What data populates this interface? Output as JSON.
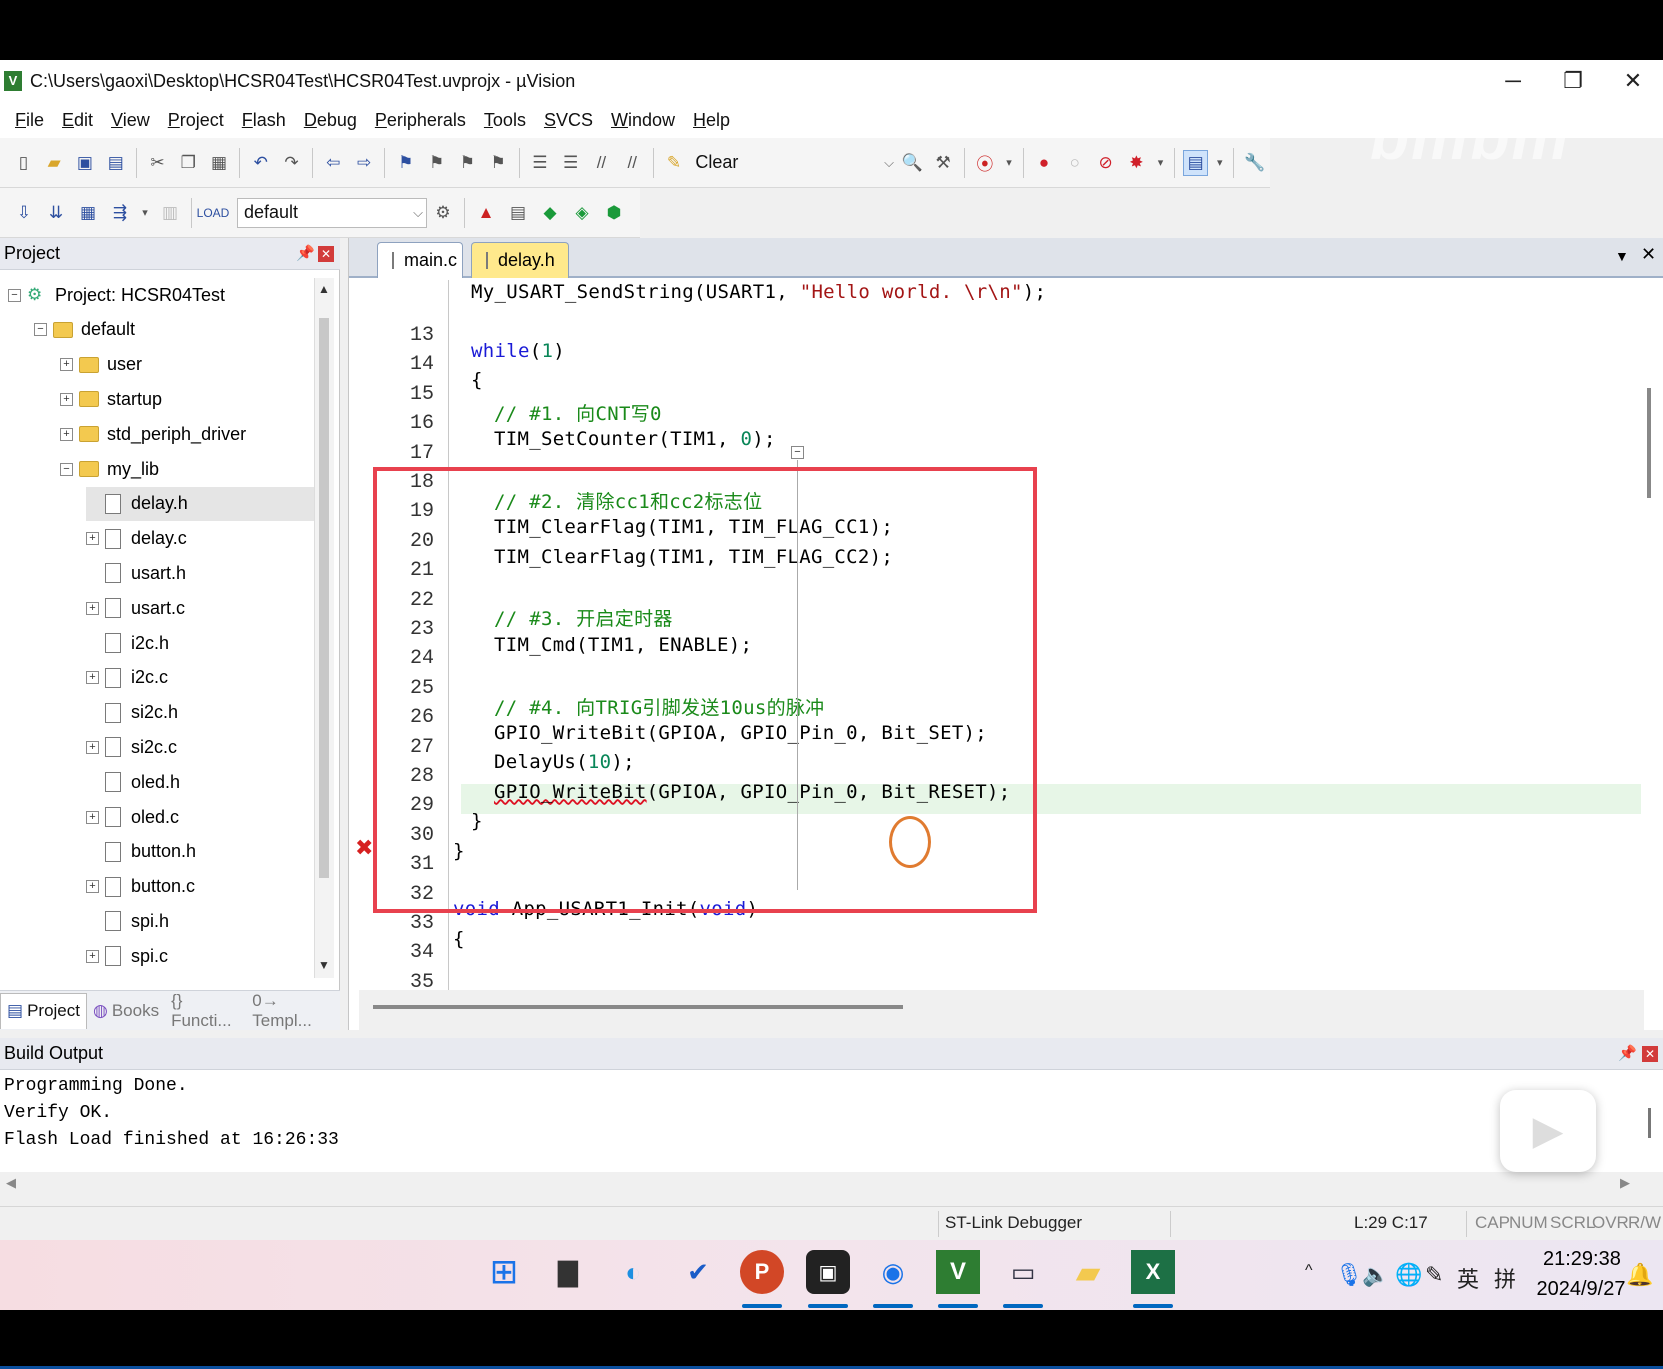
{
  "window": {
    "title": "C:\\Users\\gaoxi\\Desktop\\HCSR04Test\\HCSR04Test.uvprojx - µVision",
    "controls": {
      "minimize": "─",
      "maximize": "❐",
      "close": "✕"
    }
  },
  "menu": [
    "File",
    "Edit",
    "View",
    "Project",
    "Flash",
    "Debug",
    "Peripherals",
    "Tools",
    "SVCS",
    "Window",
    "Help"
  ],
  "toolbar1": {
    "clear_label": "Clear"
  },
  "toolbar2": {
    "target": "default"
  },
  "project_panel": {
    "header": "Project",
    "root": "Project: HCSR04Test",
    "target": "default",
    "items": [
      {
        "label": "user",
        "type": "folder",
        "expander": "+"
      },
      {
        "label": "startup",
        "type": "folder",
        "expander": "+"
      },
      {
        "label": "std_periph_driver",
        "type": "folder",
        "expander": "+"
      },
      {
        "label": "my_lib",
        "type": "folder",
        "expander": "−"
      },
      {
        "label": "delay.h",
        "type": "file",
        "expander": "",
        "selected": true
      },
      {
        "label": "delay.c",
        "type": "file",
        "expander": "+"
      },
      {
        "label": "usart.h",
        "type": "file",
        "expander": ""
      },
      {
        "label": "usart.c",
        "type": "file",
        "expander": "+"
      },
      {
        "label": "i2c.h",
        "type": "file",
        "expander": ""
      },
      {
        "label": "i2c.c",
        "type": "file",
        "expander": "+"
      },
      {
        "label": "si2c.h",
        "type": "file",
        "expander": ""
      },
      {
        "label": "si2c.c",
        "type": "file",
        "expander": "+"
      },
      {
        "label": "oled.h",
        "type": "file",
        "expander": ""
      },
      {
        "label": "oled.c",
        "type": "file",
        "expander": "+"
      },
      {
        "label": "button.h",
        "type": "file",
        "expander": ""
      },
      {
        "label": "button.c",
        "type": "file",
        "expander": "+"
      },
      {
        "label": "spi.h",
        "type": "file",
        "expander": ""
      },
      {
        "label": "spi.c",
        "type": "file",
        "expander": "+"
      }
    ],
    "tabs": [
      "Project",
      "Books",
      "{} Functi...",
      "0→ Templ..."
    ]
  },
  "editor": {
    "tabs": [
      {
        "label": "main.c",
        "active": true
      },
      {
        "label": "delay.h",
        "active": false
      }
    ],
    "lines": [
      {
        "n": "13",
        "code": "My_USART_SendString(USART1, \"Hello world. \\r\\n\");"
      },
      {
        "n": "14",
        "code": ""
      },
      {
        "n": "15",
        "code": "while(1)"
      },
      {
        "n": "16",
        "code": "{"
      },
      {
        "n": "17",
        "code": "// #1. 向CNT写0"
      },
      {
        "n": "18",
        "code": "TIM_SetCounter(TIM1, 0);"
      },
      {
        "n": "19",
        "code": ""
      },
      {
        "n": "20",
        "code": "// #2. 清除cc1和cc2标志位"
      },
      {
        "n": "21",
        "code": "TIM_ClearFlag(TIM1, TIM_FLAG_CC1);"
      },
      {
        "n": "22",
        "code": "TIM_ClearFlag(TIM1, TIM_FLAG_CC2);"
      },
      {
        "n": "23",
        "code": ""
      },
      {
        "n": "24",
        "code": "// #3. 开启定时器"
      },
      {
        "n": "25",
        "code": "TIM_Cmd(TIM1, ENABLE);"
      },
      {
        "n": "26",
        "code": ""
      },
      {
        "n": "27",
        "code": "// #4. 向TRIG引脚发送10us的脉冲"
      },
      {
        "n": "28",
        "code": "GPIO_WriteBit(GPIOA, GPIO_Pin_0, Bit_SET);"
      },
      {
        "n": "29",
        "code": "DelayUs(10);"
      },
      {
        "n": "30",
        "code": "GPIO_WriteBit(GPIOA, GPIO_Pin_0, Bit_RESET);"
      },
      {
        "n": "31",
        "code": "}"
      },
      {
        "n": "32",
        "code": "}"
      },
      {
        "n": "33",
        "code": ""
      },
      {
        "n": "34",
        "code": "void App_USART1_Init(void)"
      },
      {
        "n": "35",
        "code": "{"
      }
    ]
  },
  "build_output": {
    "header": "Build Output",
    "lines": [
      "Programming Done.",
      "Verify OK.",
      "Flash Load finished at 16:26:33"
    ]
  },
  "status": {
    "debugger": "ST-Link Debugger",
    "cursor": "L:29 C:17",
    "flags": [
      "CAP",
      "NUM",
      "SCRL",
      "OVR",
      "R/W"
    ]
  },
  "taskbar": {
    "apps": [
      "start-icon",
      "file-manager-icon",
      "edge-icon",
      "todo-icon",
      "powerpoint-icon",
      "camera-app-icon",
      "maps-icon",
      "uvision-icon",
      "terminal-icon",
      "folder-icon",
      "excel-icon"
    ],
    "tray": {
      "ime_lang": "英",
      "ime_mode": "拼"
    },
    "time": "21:29:38",
    "date": "2024/9/27"
  },
  "colors": {
    "highlight_box": "#e8414e",
    "circle": "#e07b30",
    "current_line": "#e7f6e7",
    "keyword": "#1a1ad6",
    "string": "#a31515",
    "comment": "#1a8a1a"
  }
}
